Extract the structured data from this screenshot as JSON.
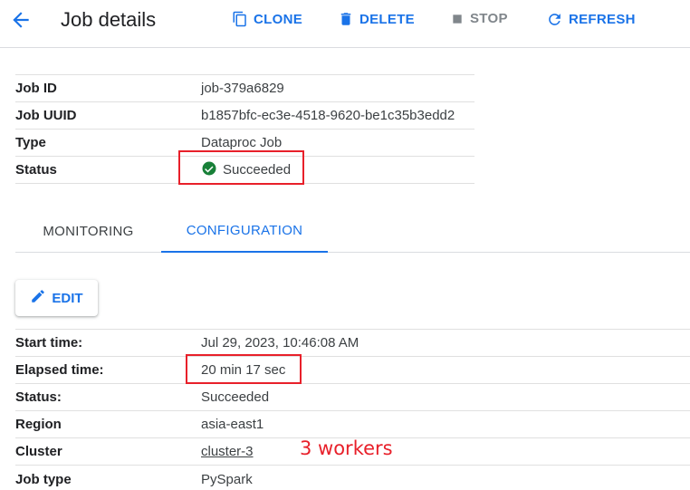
{
  "header": {
    "title": "Job details",
    "clone_label": "CLONE",
    "delete_label": "DELETE",
    "stop_label": "STOP",
    "refresh_label": "REFRESH"
  },
  "summary": {
    "rows": [
      {
        "label": "Job ID",
        "value": "job-379a6829"
      },
      {
        "label": "Job UUID",
        "value": "b1857bfc-ec3e-4518-9620-be1c35b3edd2"
      },
      {
        "label": "Type",
        "value": "Dataproc Job"
      },
      {
        "label": "Status",
        "value": "Succeeded"
      }
    ]
  },
  "tabs": [
    {
      "label": "MONITORING",
      "active": false
    },
    {
      "label": "CONFIGURATION",
      "active": true
    }
  ],
  "edit_label": "EDIT",
  "details": {
    "rows": [
      {
        "label": "Start time:",
        "value": "Jul 29, 2023, 10:46:08 AM"
      },
      {
        "label": "Elapsed time:",
        "value": "20 min 17 sec"
      },
      {
        "label": "Status:",
        "value": "Succeeded"
      },
      {
        "label": "Region",
        "value": "asia-east1"
      },
      {
        "label": "Cluster",
        "value": "cluster-3"
      },
      {
        "label": "Job type",
        "value": "PySpark"
      }
    ]
  },
  "annotation": "3 workers",
  "colors": {
    "accent": "#1a73e8",
    "success": "#188038",
    "highlight": "#e8202a"
  },
  "icons": [
    "back-arrow-icon",
    "copy-icon",
    "trash-icon",
    "stop-icon",
    "refresh-icon",
    "check-circle-icon",
    "pencil-icon"
  ]
}
